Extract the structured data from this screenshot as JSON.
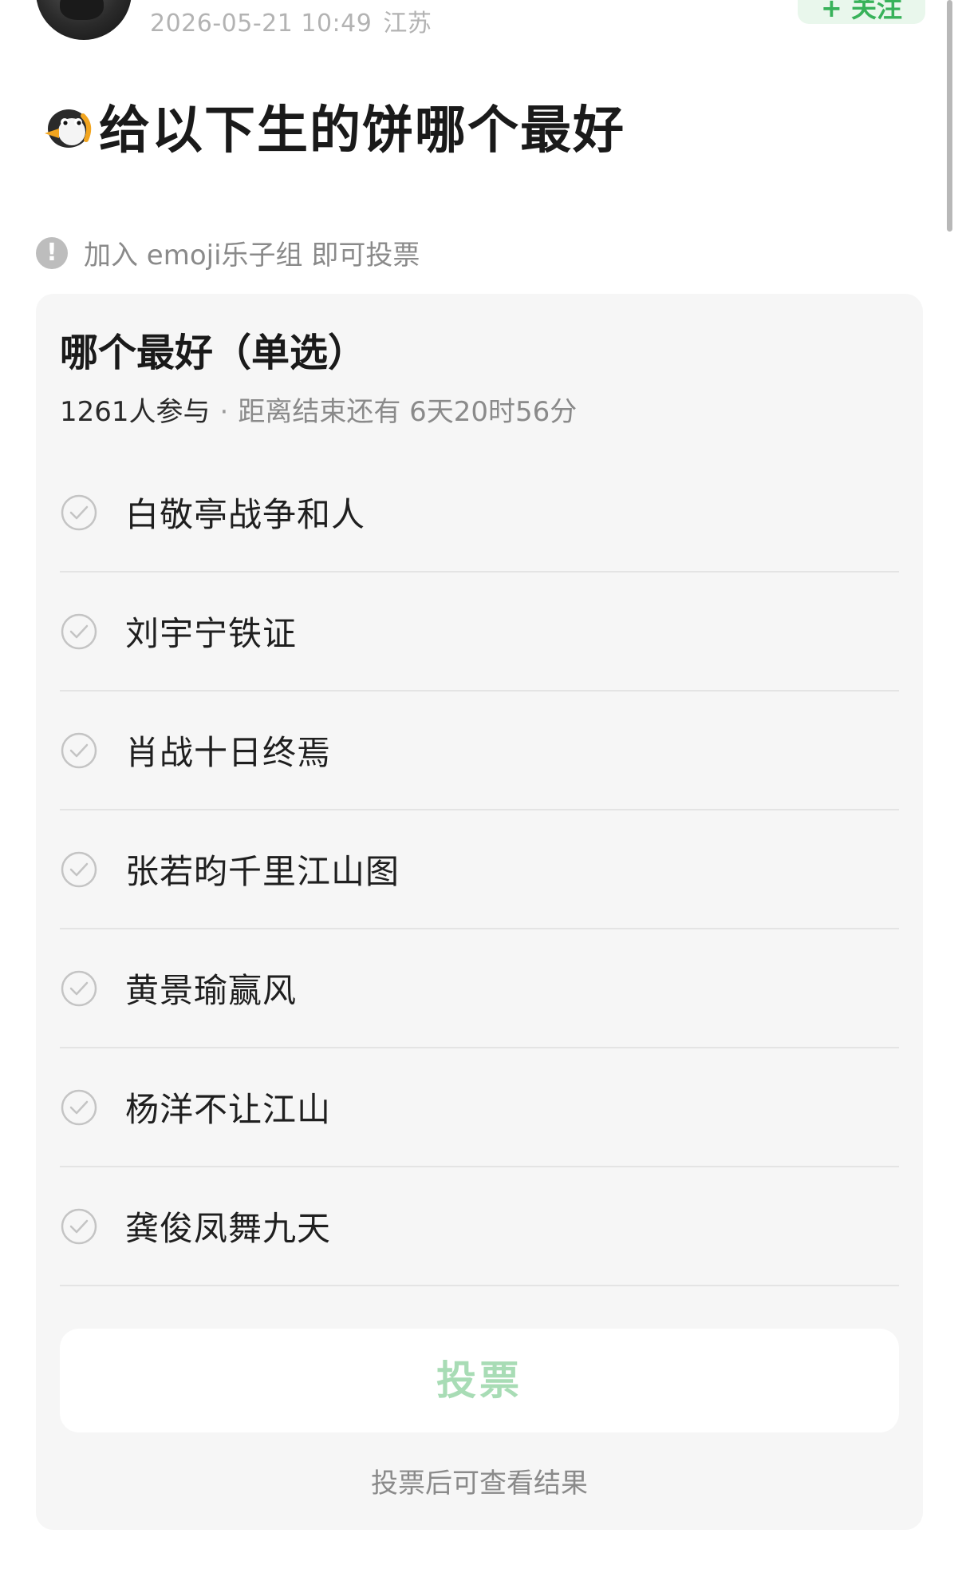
{
  "header": {
    "timestamp": "2026-05-21 10:49",
    "location": "江苏",
    "follow_label": "+ 关注"
  },
  "post": {
    "title": "给以下生的饼哪个最好",
    "title_icon": "penguin-emoji-icon"
  },
  "notice": {
    "icon": "exclamation-icon",
    "text": "加入 emoji乐子组 即可投票"
  },
  "poll": {
    "title": "哪个最好（单选）",
    "participants": "1261人参与",
    "separator": "·",
    "time_left": "距离结束还有 6天20时56分",
    "options": [
      {
        "label": "白敬亭战争和人"
      },
      {
        "label": "刘宇宁铁证"
      },
      {
        "label": "肖战十日终焉"
      },
      {
        "label": "张若昀千里江山图"
      },
      {
        "label": "黄景瑜赢风"
      },
      {
        "label": "杨洋不让江山"
      },
      {
        "label": "龚俊凤舞九天"
      }
    ],
    "vote_label": "投票",
    "vote_hint": "投票后可查看结果"
  },
  "colors": {
    "accent_green": "#38b25a",
    "vote_disabled": "#a8dcb5",
    "card_bg": "#f6f6f6"
  }
}
